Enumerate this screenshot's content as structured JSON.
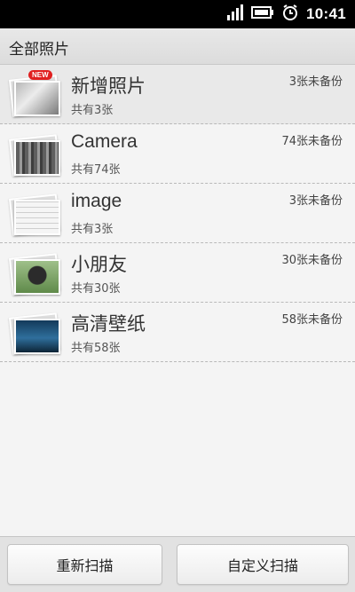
{
  "status_bar": {
    "time": "10:41",
    "icons": [
      "signal-icon",
      "battery-icon",
      "alarm-icon"
    ]
  },
  "header": {
    "title": "全部照片"
  },
  "albums": [
    {
      "name": "新增照片",
      "count_text": "共有3张",
      "status": "3张未备份",
      "badge": "NEW",
      "thumb": "photo-stack-group"
    },
    {
      "name": "Camera",
      "count_text": "共有74张",
      "status": "74张未备份",
      "thumb": "photo-stack-crowd"
    },
    {
      "name": "image",
      "count_text": "共有3张",
      "status": "3张未备份",
      "thumb": "photo-stack-grid"
    },
    {
      "name": "小朋友",
      "count_text": "共有30张",
      "status": "30张未备份",
      "thumb": "photo-stack-child"
    },
    {
      "name": "高清壁纸",
      "count_text": "共有58张",
      "status": "58张未备份",
      "thumb": "photo-stack-wallpaper"
    }
  ],
  "buttons": {
    "rescan": "重新扫描",
    "custom_scan": "自定义扫描"
  },
  "colors": {
    "status_bar_bg": "#000000",
    "header_bg": "#dcdcdc",
    "list_bg": "#f4f4f4",
    "badge_red": "#e02020"
  }
}
